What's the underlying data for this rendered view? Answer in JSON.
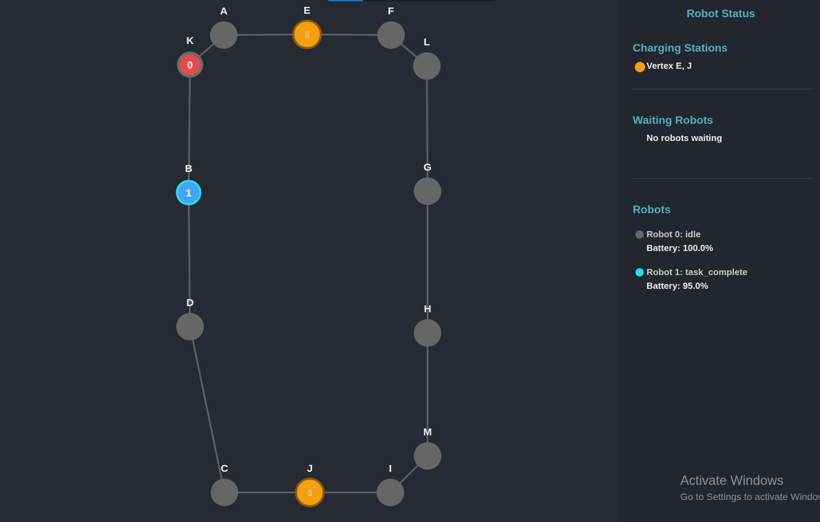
{
  "graph": {
    "nodes": [
      {
        "id": "A",
        "label": "A",
        "state": "idle",
        "text": ""
      },
      {
        "id": "E",
        "label": "E",
        "state": "charging",
        "text": "",
        "icon": "charging-icon"
      },
      {
        "id": "F",
        "label": "F",
        "state": "idle",
        "text": ""
      },
      {
        "id": "K",
        "label": "K",
        "state": "robot-0",
        "text": "0"
      },
      {
        "id": "L",
        "label": "L",
        "state": "idle",
        "text": ""
      },
      {
        "id": "B",
        "label": "B",
        "state": "robot-1",
        "text": "1"
      },
      {
        "id": "G",
        "label": "G",
        "state": "idle",
        "text": ""
      },
      {
        "id": "D",
        "label": "D",
        "state": "idle",
        "text": ""
      },
      {
        "id": "H",
        "label": "H",
        "state": "idle",
        "text": ""
      },
      {
        "id": "M",
        "label": "M",
        "state": "idle",
        "text": ""
      },
      {
        "id": "C",
        "label": "C",
        "state": "idle",
        "text": ""
      },
      {
        "id": "J",
        "label": "J",
        "state": "charging",
        "text": "",
        "icon": "charging-icon"
      },
      {
        "id": "I",
        "label": "I",
        "state": "idle",
        "text": ""
      }
    ],
    "edges": [
      [
        "K",
        "A"
      ],
      [
        "A",
        "E"
      ],
      [
        "E",
        "F"
      ],
      [
        "F",
        "L"
      ],
      [
        "L",
        "G"
      ],
      [
        "G",
        "H"
      ],
      [
        "H",
        "M"
      ],
      [
        "M",
        "I"
      ],
      [
        "I",
        "J"
      ],
      [
        "J",
        "C"
      ],
      [
        "C",
        "D"
      ],
      [
        "D",
        "B"
      ],
      [
        "B",
        "K"
      ]
    ]
  },
  "colors": {
    "idle_node": "#666666",
    "charging_node": "#f5a010",
    "robot0": "#e8494f",
    "robot1": "#42a5f5",
    "robot1_ring": "#22e0f0",
    "accent": "#52b0c4"
  },
  "panel": {
    "title": "Robot Status",
    "charging": {
      "heading": "Charging Stations",
      "text": "Vertex E, J"
    },
    "waiting": {
      "heading": "Waiting Robots",
      "text": "No robots waiting"
    },
    "robots": {
      "heading": "Robots",
      "items": [
        {
          "status": "Robot 0: idle",
          "battery": "Battery: 100.0%",
          "color": "#666666"
        },
        {
          "status": "Robot 1: task_complete",
          "battery": "Battery: 95.0%",
          "color": "#22e0f0"
        }
      ]
    }
  },
  "watermark": {
    "title": "Activate Windows",
    "subtitle": "Go to Settings to activate Windows."
  }
}
